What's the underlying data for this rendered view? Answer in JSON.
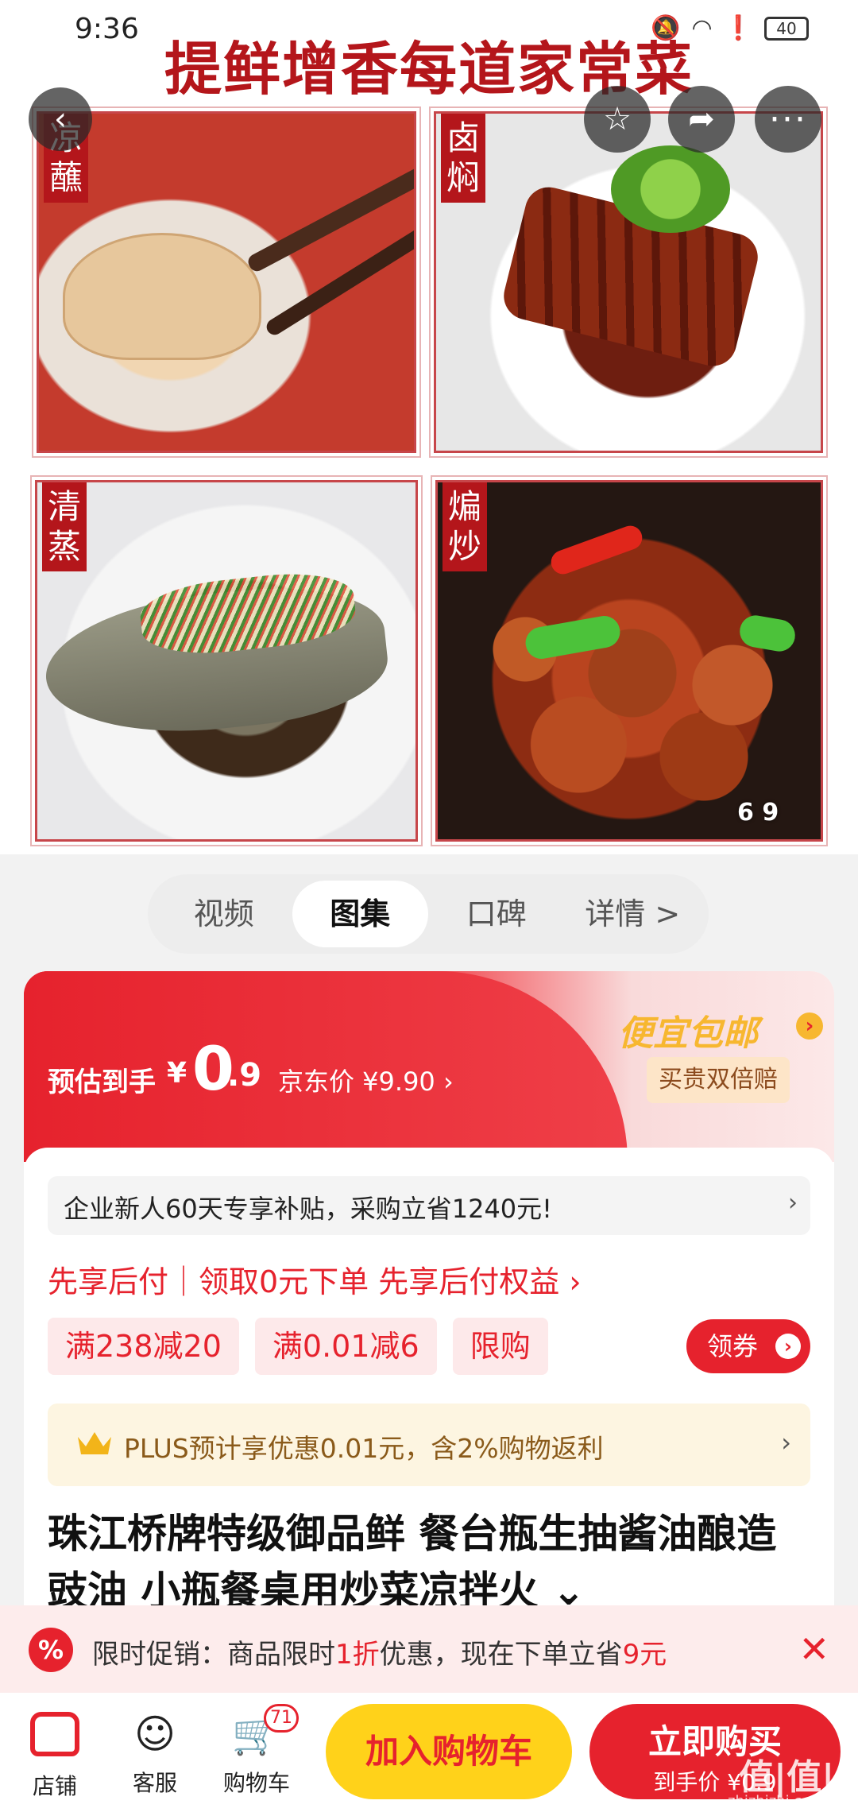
{
  "status_bar": {
    "time": "9:36",
    "battery": "40"
  },
  "hero": {
    "title": "提鲜增香每道家常菜",
    "tiles": [
      {
        "tag": "凉蘸"
      },
      {
        "tag": "卤焖"
      },
      {
        "tag": "清蒸"
      },
      {
        "tag": "煸炒"
      }
    ],
    "counter": "6  9"
  },
  "tabs": [
    "视频",
    "图集",
    "口碑",
    "详情 >"
  ],
  "price": {
    "est_label": "预估到手",
    "currency": "¥",
    "big": "0",
    "small": ".9",
    "jd_price": "京东价 ¥9.90 ›",
    "cheap_ship": "便宜包邮",
    "double_badge": "买贵双倍赔"
  },
  "enterprise": {
    "text": "企业新人60天专享补贴，采购立省1240元!",
    "arrow": "›"
  },
  "pay_later": "先享后付｜领取0元下单 先享后付权益 ›",
  "coupons": [
    "满238减20",
    "满0.01减6",
    "限购"
  ],
  "get_coupon": "领券",
  "plus": {
    "text": "PLUS预计享优惠0.01元，含2%购物返利",
    "arrow": "›"
  },
  "product_title": "珠江桥牌特级御品鲜 餐台瓶生抽酱油酿造豉油 小瓶餐桌用炒菜凉拌火 ⌄",
  "promo": {
    "icon": "%",
    "prefix": "限时促销：商品限时",
    "discount": "1折",
    "mid": "优惠，现在下单立省",
    "save": "9元",
    "close": "✕"
  },
  "bottom_bar": {
    "store": "店铺",
    "service": "客服",
    "cart": "购物车",
    "cart_count": "71",
    "add_cart": "加入购物车",
    "buy_now": "立即购买",
    "buy_now_sub": "到手价 ¥0.9"
  },
  "watermark": {
    "main": "值|值|值",
    "sub": "zhizhizhi.com"
  },
  "colors": {
    "brand_red": "#e6222d",
    "yellow": "#ffd21a",
    "gold": "#f7b730"
  }
}
